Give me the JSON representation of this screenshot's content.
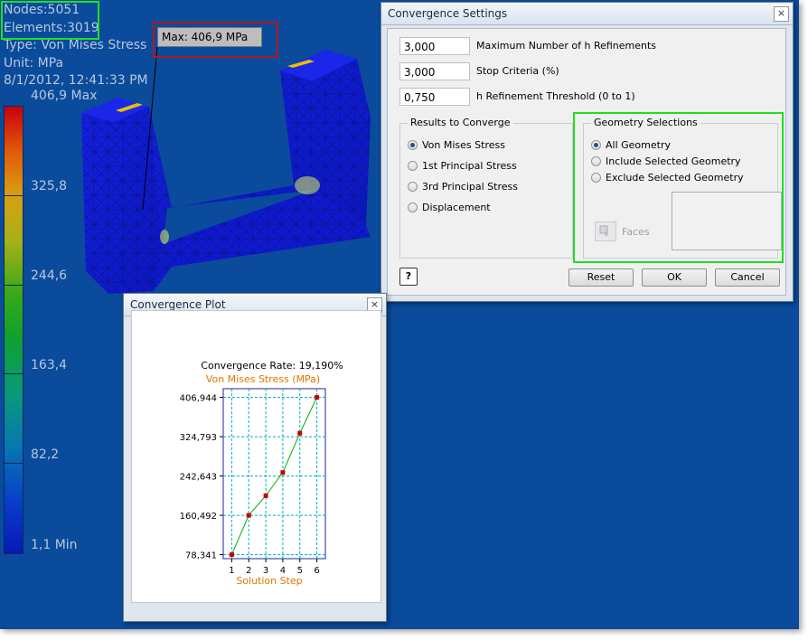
{
  "viewport": {
    "info_lines": [
      "Nodes:5051",
      "Elements:3019",
      "Type: Von Mises Stress",
      "Unit: MPa",
      "8/1/2012, 12:41:33 PM"
    ],
    "max_callout": "Max: 406,9 MPa",
    "legend": {
      "max_label": "406,9 Max",
      "labels": [
        "325,8",
        "244,6",
        "163,4",
        "82,2"
      ],
      "min_label": "1,1 Min"
    }
  },
  "settings": {
    "title": "Convergence Settings",
    "close": "×",
    "fields": [
      {
        "value": "3,000",
        "label": "Maximum Number of h Refinements"
      },
      {
        "value": "3,000",
        "label": "Stop Criteria (%)"
      },
      {
        "value": "0,750",
        "label": "h Refinement Threshold (0 to 1)"
      }
    ],
    "results_group": {
      "title": "Results to Converge",
      "options": [
        {
          "label": "Von Mises Stress",
          "selected": true
        },
        {
          "label": "1st Principal Stress",
          "selected": false
        },
        {
          "label": "3rd Principal Stress",
          "selected": false
        },
        {
          "label": "Displacement",
          "selected": false
        }
      ]
    },
    "geometry_group": {
      "title": "Geometry Selections",
      "options": [
        {
          "label": "All Geometry",
          "selected": true
        },
        {
          "label": "Include Selected Geometry",
          "selected": false
        },
        {
          "label": "Exclude Selected Geometry",
          "selected": false
        }
      ],
      "faces_label": "Faces"
    },
    "help_label": "?",
    "buttons": {
      "reset": "Reset",
      "ok": "OK",
      "cancel": "Cancel"
    }
  },
  "plot_window": {
    "title": "Convergence Plot",
    "close": "×"
  },
  "chart_data": {
    "type": "line",
    "title": "Convergence Rate: 19,190%",
    "subtitle": "Von Mises Stress (MPa)",
    "xlabel": "Solution Step",
    "x": [
      1,
      2,
      3,
      4,
      5,
      6
    ],
    "values": [
      78.341,
      160.492,
      201.5,
      250.0,
      332.0,
      406.944
    ],
    "xlim": [
      0.5,
      6.5
    ],
    "ylim": [
      70,
      425
    ],
    "yticks": [
      {
        "value": 406.944,
        "label": "406,944"
      },
      {
        "value": 324.793,
        "label": "324,793"
      },
      {
        "value": 242.643,
        "label": "242,643"
      },
      {
        "value": 160.492,
        "label": "160,492"
      },
      {
        "value": 78.341,
        "label": "78,341"
      }
    ],
    "grid": true,
    "colors": {
      "line": "#00b000",
      "marker": "#cc0000",
      "grid": "#00b0c8",
      "axis": "#2020a0",
      "subtitle": "#e07800"
    }
  }
}
